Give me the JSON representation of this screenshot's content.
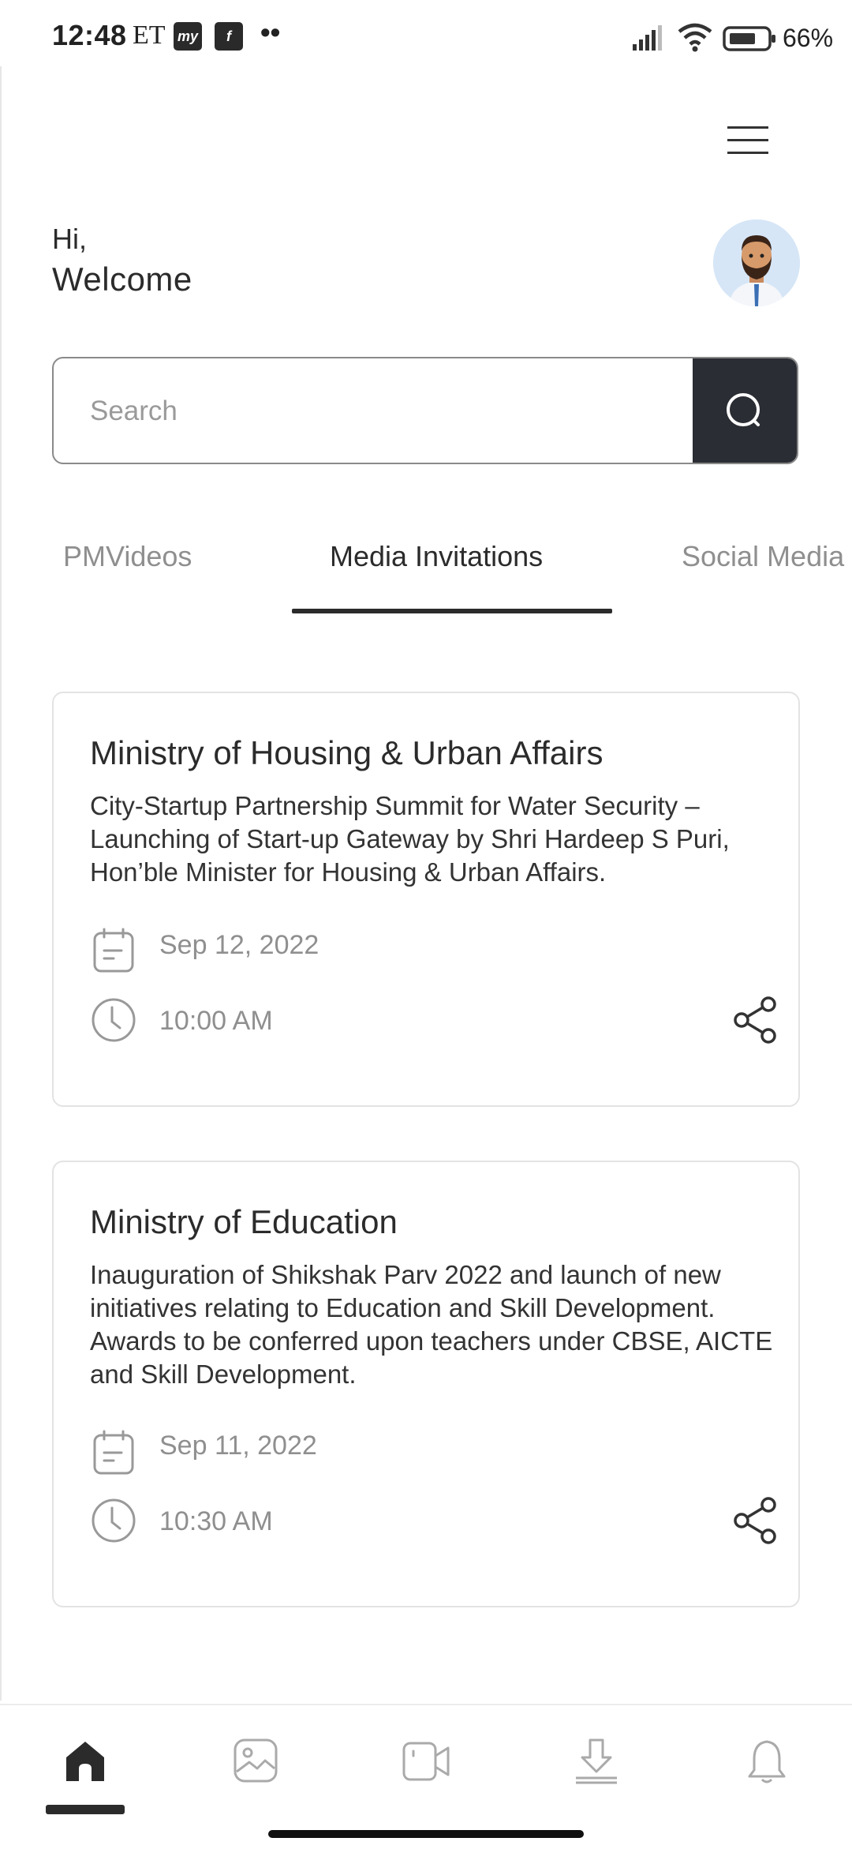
{
  "status_bar": {
    "time": "12:48",
    "et_label": "ET",
    "app_icon_1": "my",
    "app_icon_2": "f",
    "dots": "••",
    "battery": "66%",
    "icons": [
      "signal-icon",
      "wifi-icon",
      "battery-icon"
    ]
  },
  "header": {
    "menu_icon": "hamburger-icon"
  },
  "greeting": {
    "hi": "Hi,",
    "welcome": "Welcome",
    "avatar": "user-avatar"
  },
  "search": {
    "placeholder": "Search",
    "value": "",
    "icon": "search-icon"
  },
  "tabs": [
    {
      "label": "PMVideos",
      "active": false
    },
    {
      "label": "Media Invitations",
      "active": true
    },
    {
      "label": "Social Media",
      "active": false
    }
  ],
  "invitations": [
    {
      "title": "Ministry of Housing & Urban Affairs",
      "description": "City-Startup Partnership Summit for Water Security – Launching of Start-up Gateway by Shri Hardeep S Puri, Hon’ble Minister for  Housing & Urban Affairs.",
      "date": "Sep 12, 2022",
      "time": "10:00 AM"
    },
    {
      "title": "Ministry of Education",
      "description": "Inauguration of Shikshak Parv 2022 and launch of new initiatives relating to Education and Skill Development.  Awards to be conferred upon teachers under CBSE, AICTE and Skill Development.",
      "date": "Sep 11, 2022",
      "time": "10:30 AM"
    }
  ],
  "bottom_nav": [
    {
      "icon": "home-icon",
      "active": true
    },
    {
      "icon": "gallery-icon",
      "active": false
    },
    {
      "icon": "video-icon",
      "active": false
    },
    {
      "icon": "download-icon",
      "active": false
    },
    {
      "icon": "bell-icon",
      "active": false
    }
  ],
  "colors": {
    "accent_dark": "#2a2d33",
    "muted_text": "#8f8f8f",
    "border": "#e3e3e3"
  }
}
